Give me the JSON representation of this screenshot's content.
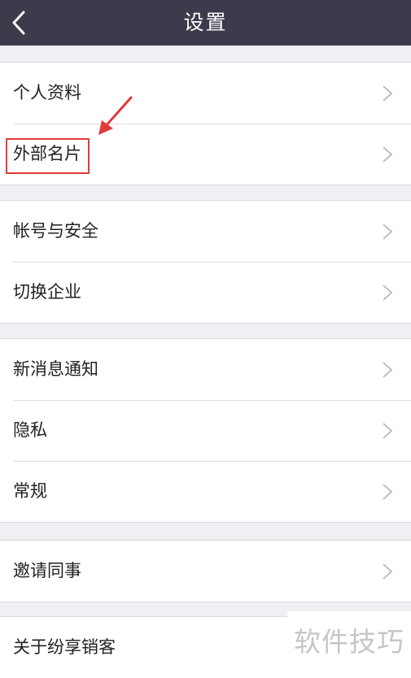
{
  "header": {
    "title": "设置"
  },
  "groups": [
    {
      "items": [
        {
          "label": "个人资料"
        },
        {
          "label": "外部名片"
        }
      ]
    },
    {
      "items": [
        {
          "label": "帐号与安全"
        },
        {
          "label": "切换企业"
        }
      ]
    },
    {
      "items": [
        {
          "label": "新消息通知"
        },
        {
          "label": "隐私"
        },
        {
          "label": "常规"
        }
      ]
    },
    {
      "items": [
        {
          "label": "邀请同事"
        }
      ]
    },
    {
      "items": [
        {
          "label": "关于纷享销客"
        }
      ]
    }
  ],
  "annotation": {
    "highlight_color": "#e03b3b"
  },
  "watermark": {
    "text": "软件技巧"
  }
}
